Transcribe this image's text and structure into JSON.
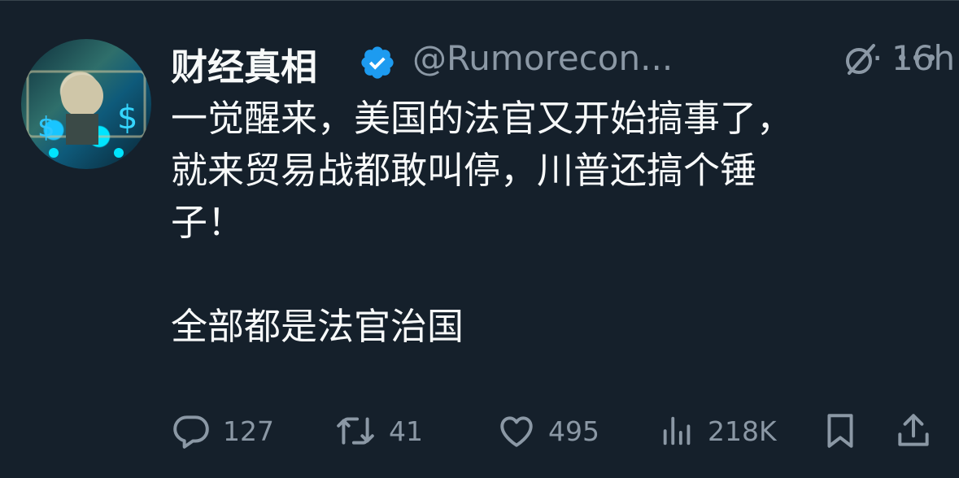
{
  "tweet": {
    "author_name": "财经真相",
    "handle": "@Rumorecon...",
    "separator": "·",
    "time": "16h",
    "text_paragraph_1": "一觉醒来，美国的法官又开始搞事了，\n就来贸易战都敢叫停，川普还搞个锤\n子！",
    "text_paragraph_2": "全部都是法官治国",
    "verified": true
  },
  "actions": {
    "replies": "127",
    "retweets": "41",
    "likes": "495",
    "views": "218K"
  },
  "icons": {
    "verified_badge": "verified-badge-icon",
    "grok": "grok-icon",
    "more": "more-icon",
    "reply": "reply-icon",
    "retweet": "retweet-icon",
    "like": "like-icon",
    "views": "views-icon",
    "bookmark": "bookmark-icon",
    "share": "share-icon"
  },
  "colors": {
    "background": "#15202b",
    "text_primary": "#f7f9f9",
    "text_secondary": "#8b98a5",
    "verified_blue": "#1d9bf0"
  }
}
